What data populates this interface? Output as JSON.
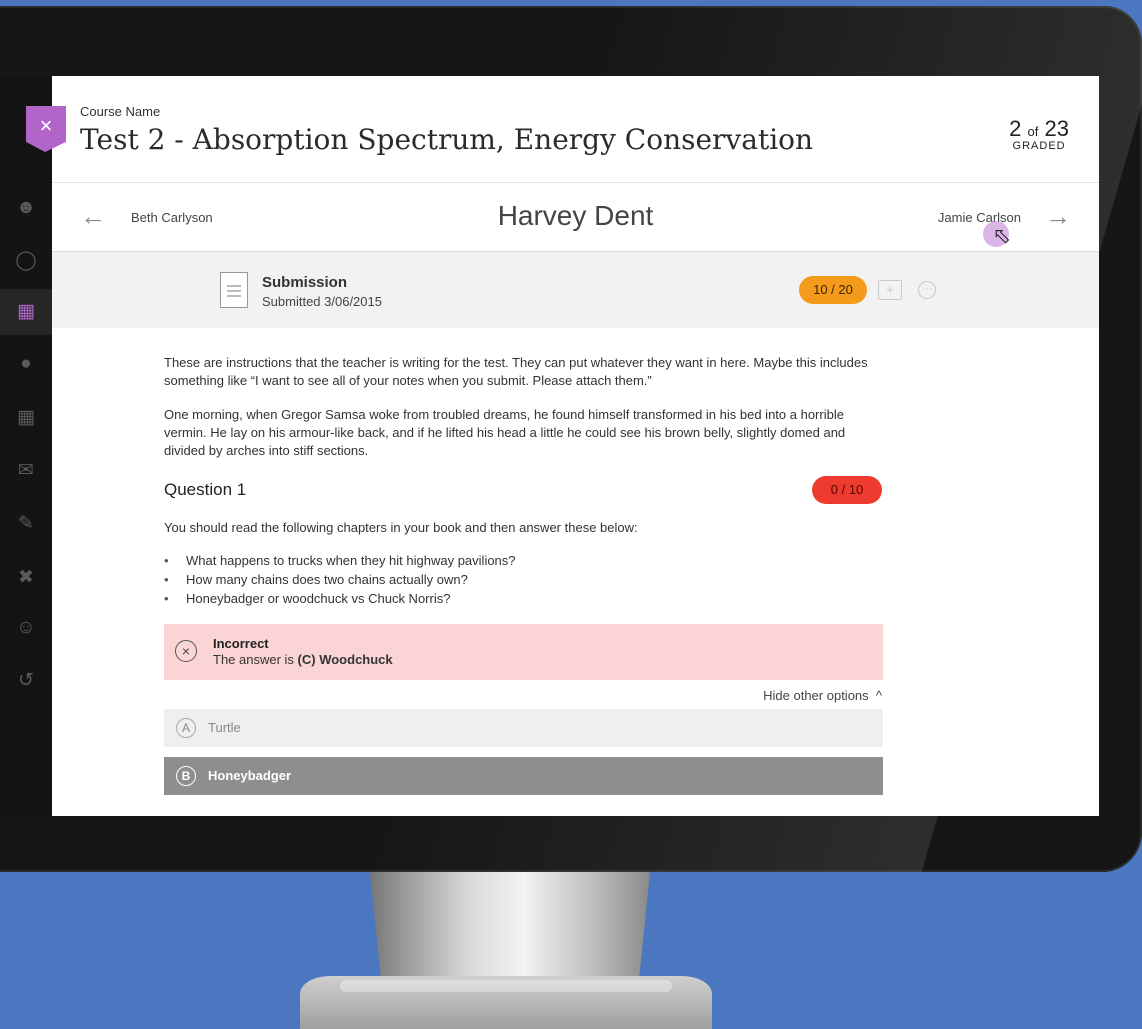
{
  "header": {
    "course_name": "Course Name",
    "test_title": "Test 2 - Absorption Spectrum, Energy Conservation",
    "graded_count": "2",
    "graded_of": "of",
    "graded_total": "23",
    "graded_label": "GRADED",
    "close_icon": "×"
  },
  "student_nav": {
    "prev_student": "Beth Carlyson",
    "current_student": "Harvey Dent",
    "next_student": "Jamie Carlson",
    "prev_arrow": "←",
    "next_arrow": "→"
  },
  "submission": {
    "title": "Submission",
    "date": "Submitted 3/06/2015",
    "score": "10 / 20"
  },
  "content": {
    "instructions": "These are instructions that the teacher is writing for the test. They can put whatever they want in here. Maybe this includes something like “I want to see all of your notes when you submit. Please attach them.”",
    "story": "One morning, when Gregor Samsa woke from troubled dreams, he found himself transformed in his bed into a horrible vermin. He lay on his armour-like back, and if he lifted his head a little he could see his brown belly, slightly domed and divided by arches into stiff sections.",
    "question": {
      "title": "Question 1",
      "score": "0 / 10",
      "text": "You should read the following chapters in your book and then answer these below:",
      "bullets": [
        "What happens to trucks when they hit highway pavilions?",
        "How many chains does two chains actually own?",
        "Honeybadger or woodchuck vs Chuck Norris?"
      ],
      "result_title": "Incorrect",
      "result_prefix": "The answer is",
      "result_answer": "(C) Woodchuck",
      "hide_options": "Hide other options",
      "options": [
        {
          "letter": "A",
          "label": "Turtle"
        },
        {
          "letter": "B",
          "label": "Honeybadger"
        }
      ]
    }
  },
  "icons": {
    "sidebar": [
      "user-icon",
      "globe-icon",
      "courses-icon",
      "groups-icon",
      "calendar-icon",
      "mail-icon",
      "grades-icon",
      "tools-icon",
      "account-icon",
      "logout-icon"
    ]
  }
}
